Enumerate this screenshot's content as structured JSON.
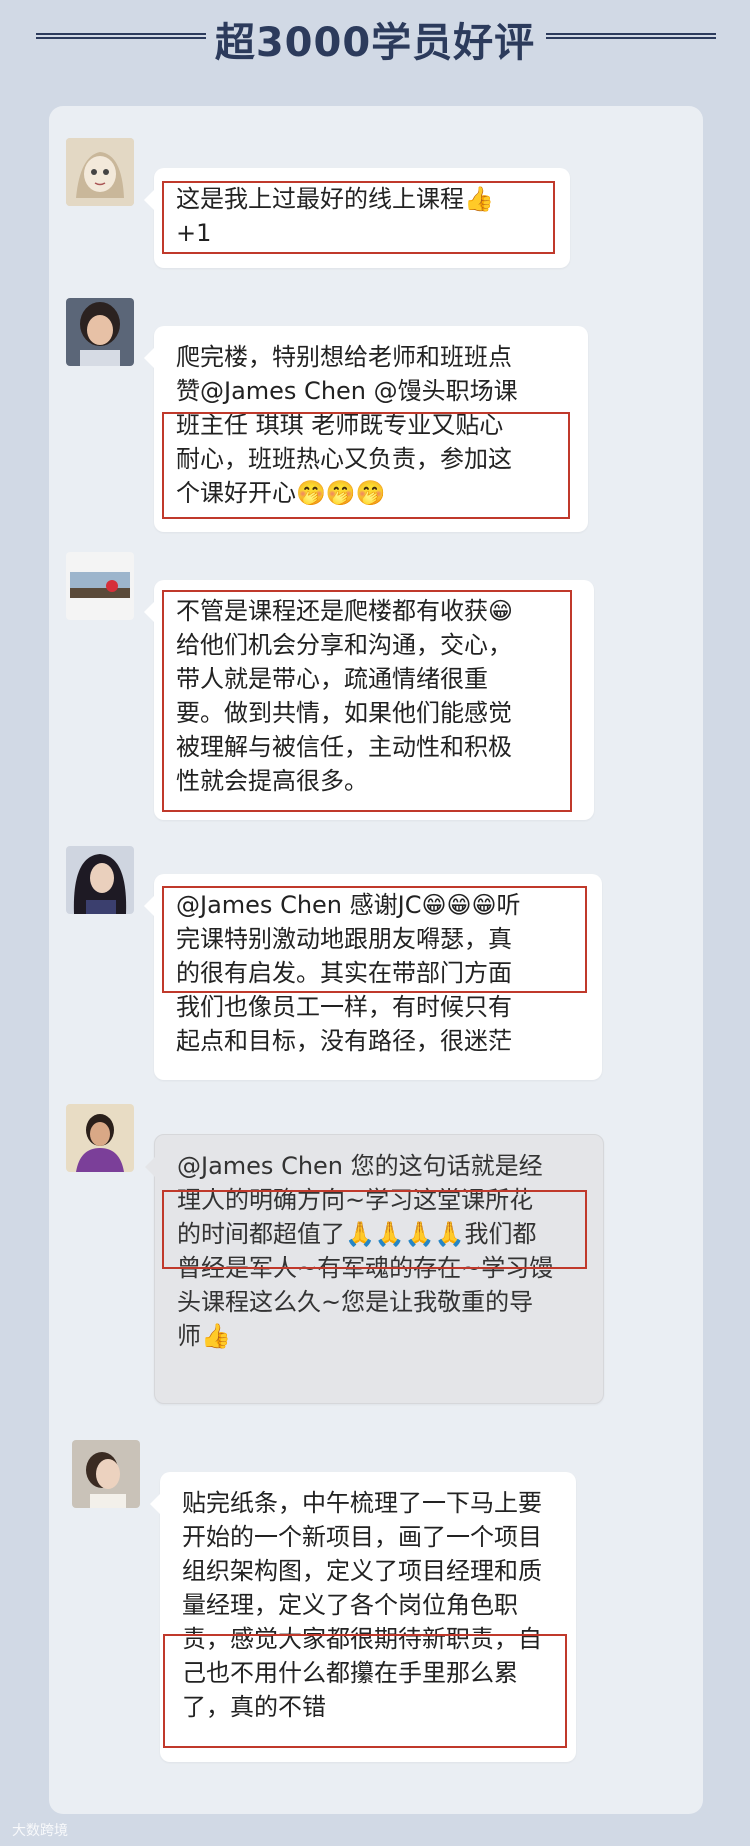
{
  "header": {
    "title": "超3000学员好评"
  },
  "reviews": [
    {
      "lines": [
        "这是我上过最好的线上课程👍",
        "+1"
      ],
      "avatar_icon": "cartoon-girl-avatar-icon"
    },
    {
      "lines": [
        "爬完楼，特别想给老师和班班点",
        "赞@James Chen @馒头职场课",
        "班主任 琪琪 老师既专业又贴心",
        "耐心，班班热心又负责，参加这",
        "个课好开心🤭🤭🤭"
      ],
      "avatar_icon": "woman-portrait-avatar-icon"
    },
    {
      "lines": [
        "不管是课程还是爬楼都有收获😁",
        "给他们机会分享和沟通，交心，",
        "带人就是带心，疏通情绪很重",
        "要。做到共情，如果他们能感觉",
        "被理解与被信任，主动性和积极",
        "性就会提高很多。"
      ],
      "avatar_icon": "landscape-avatar-icon"
    },
    {
      "lines": [
        "@James Chen 感谢JC😁😁😁听",
        "完课特别激动地跟朋友嘚瑟，真",
        "的很有启发。其实在带部门方面",
        "我们也像员工一样，有时候只有",
        "起点和目标，没有路径，很迷茫"
      ],
      "avatar_icon": "woman-dark-hair-avatar-icon"
    },
    {
      "lines": [
        "@James Chen 您的这句话就是经",
        "理人的明确方向~学习这堂课所花",
        "的时间都超值了🙏🙏🙏🙏我们都",
        "曾经是军人~有军魂的存在~学习馒",
        "头课程这么久~您是让我敬重的导",
        "师👍"
      ],
      "avatar_icon": "woman-purple-avatar-icon"
    },
    {
      "lines": [
        "贴完纸条，中午梳理了一下马上要",
        "开始的一个新项目，画了一个项目",
        "组织架构图，定义了项目经理和质",
        "量经理，定义了各个岗位角色职",
        "责，感觉大家都很期待新职责，自",
        "己也不用什么都攥在手里那么累",
        "了，真的不错"
      ],
      "avatar_icon": "woman-profile-avatar-icon"
    }
  ],
  "watermark": {
    "text": "大数跨境"
  },
  "colors": {
    "accent": "#2c3b5c",
    "highlight": "#c0392b"
  }
}
